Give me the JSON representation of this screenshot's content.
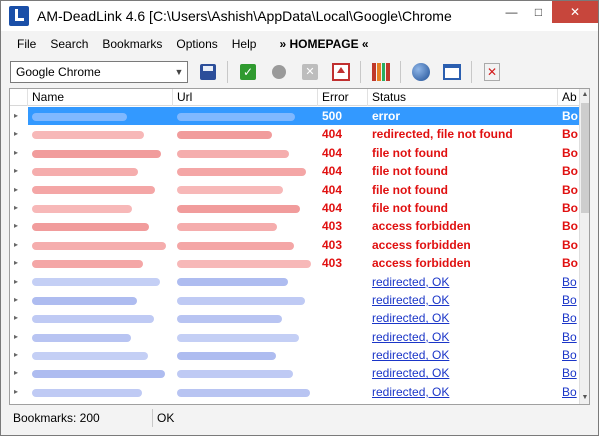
{
  "window": {
    "title": "AM-DeadLink 4.6     [C:\\Users\\Ashish\\AppData\\Local\\Google\\Chrome",
    "controls": [
      "minimize",
      "maximize",
      "close"
    ]
  },
  "menu": {
    "items": [
      "File",
      "Search",
      "Bookmarks",
      "Options",
      "Help"
    ],
    "homepage": "» HOMEPAGE «"
  },
  "toolbar": {
    "browser_select": "Google Chrome",
    "buttons": [
      "save-icon",
      "check-icon",
      "apple-icon",
      "cancel-icon",
      "home-icon",
      "books-icon",
      "globe-icon",
      "window-icon",
      "delete-icon"
    ]
  },
  "list": {
    "columns": [
      "",
      "Name",
      "Url",
      "Error",
      "Status",
      "Ab"
    ],
    "rows": [
      {
        "error": "500",
        "status": "error",
        "ab": "Bo",
        "kind": "red",
        "selected": true
      },
      {
        "error": "404",
        "status": "redirected, file not found",
        "ab": "Bo",
        "kind": "red",
        "selected": false
      },
      {
        "error": "404",
        "status": "file not found",
        "ab": "Bo",
        "kind": "red",
        "selected": false
      },
      {
        "error": "404",
        "status": "file not found",
        "ab": "Bo",
        "kind": "red",
        "selected": false
      },
      {
        "error": "404",
        "status": "file not found",
        "ab": "Bo",
        "kind": "red",
        "selected": false
      },
      {
        "error": "404",
        "status": "file not found",
        "ab": "Bo",
        "kind": "red",
        "selected": false
      },
      {
        "error": "403",
        "status": "access forbidden",
        "ab": "Bo",
        "kind": "red",
        "selected": false
      },
      {
        "error": "403",
        "status": "access forbidden",
        "ab": "Bo",
        "kind": "red",
        "selected": false
      },
      {
        "error": "403",
        "status": "access forbidden",
        "ab": "Bo",
        "kind": "red",
        "selected": false
      },
      {
        "error": "",
        "status": "redirected, OK",
        "ab": "Bo",
        "kind": "ok",
        "selected": false
      },
      {
        "error": "",
        "status": "redirected, OK",
        "ab": "Bo",
        "kind": "ok",
        "selected": false
      },
      {
        "error": "",
        "status": "redirected, OK",
        "ab": "Bo",
        "kind": "ok",
        "selected": false
      },
      {
        "error": "",
        "status": "redirected, OK",
        "ab": "Bo",
        "kind": "ok",
        "selected": false
      },
      {
        "error": "",
        "status": "redirected, OK",
        "ab": "Bo",
        "kind": "ok",
        "selected": false
      },
      {
        "error": "",
        "status": "redirected, OK",
        "ab": "Bo",
        "kind": "ok",
        "selected": false
      },
      {
        "error": "",
        "status": "redirected, OK",
        "ab": "Bo",
        "kind": "ok",
        "selected": false
      }
    ]
  },
  "statusbar": {
    "left": "Bookmarks: 200",
    "right": "OK"
  },
  "colors": {
    "selection": "#3399ff",
    "error_red": "#e01010",
    "ok_blue": "#1a35c8"
  }
}
